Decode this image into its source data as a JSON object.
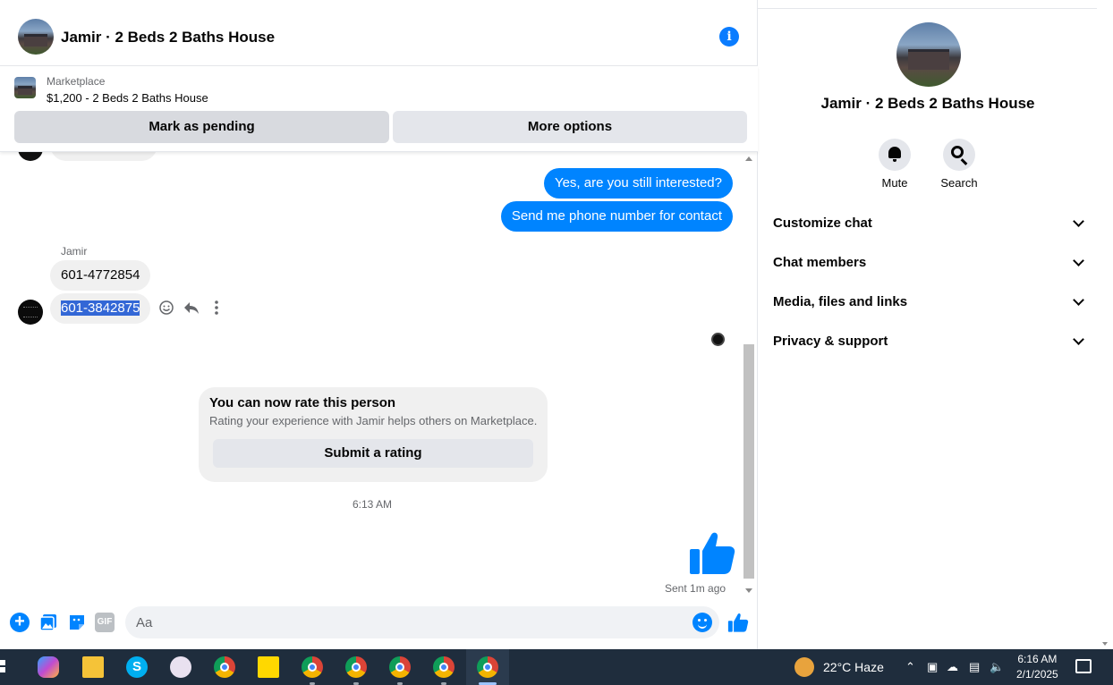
{
  "header": {
    "title": "Jamir · 2 Beds 2 Baths House"
  },
  "marketplace": {
    "label": "Marketplace",
    "item": "$1,200 - 2 Beds 2 Baths House",
    "pending_button": "Mark as pending",
    "more_button": "More options"
  },
  "messages": {
    "outgoing": [
      "Yes, are you still interested?",
      "Send me phone number for contact"
    ],
    "sender_name": "Jamir",
    "incoming": [
      "601-4772854",
      "601-3842875"
    ]
  },
  "rating": {
    "title": "You can now rate this person",
    "subtitle": "Rating your experience with Jamir helps others on Marketplace.",
    "button": "Submit a rating"
  },
  "timestamp": "6:13 AM",
  "sent_status": "Sent 1m ago",
  "composer": {
    "placeholder": "Aa",
    "gif_label": "GIF"
  },
  "sidebar": {
    "title": "Jamir · 2 Beds 2 Baths House",
    "actions": [
      "Mute",
      "Search"
    ],
    "sections": [
      "Customize chat",
      "Chat members",
      "Media, files and links",
      "Privacy & support"
    ]
  },
  "taskbar": {
    "weather": "22°C  Haze",
    "time": "6:16 AM",
    "date": "2/1/2025",
    "skype_letter": "S"
  },
  "colors": {
    "accent": "#0084ff",
    "bubble_in": "#f0f0f0",
    "taskbar": "#1f2d3d"
  }
}
